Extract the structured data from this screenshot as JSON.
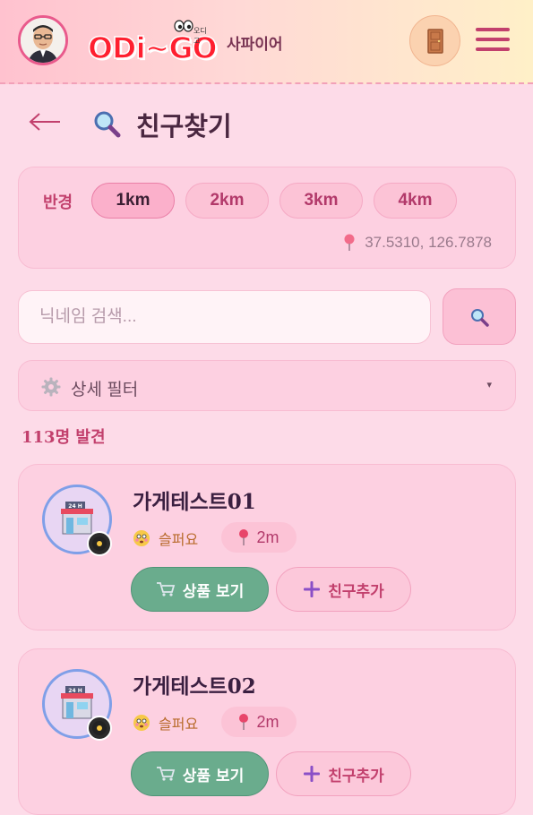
{
  "header": {
    "logo_text": "ODi~GO",
    "logo_small_text": "오디고",
    "username": "사파이어",
    "icons": {
      "avatar": "profile-photo",
      "door": "door-icon",
      "menu": "hamburger-menu-icon"
    }
  },
  "page": {
    "back_icon": "arrow-left-icon",
    "title_icon": "magnifier-icon",
    "title": "친구찾기"
  },
  "radius": {
    "label": "반경",
    "options": [
      "1km",
      "2km",
      "3km",
      "4km"
    ],
    "selected": "1km",
    "location_icon": "pushpin-icon",
    "coordinates": "37.5310, 126.7878"
  },
  "search": {
    "placeholder": "닉네임 검색...",
    "value": "",
    "button_icon": "magnifier-icon"
  },
  "filter": {
    "icon": "gear-icon",
    "label": "상세 필터",
    "caret": "▾"
  },
  "results": {
    "count_text": "113명 발견",
    "items": [
      {
        "name": "가게테스트01",
        "avatar_icon": "convenience-store-icon",
        "mood_icon": "flushed-face-icon",
        "mood": "슬퍼요",
        "distance": "2m",
        "products_label": "상품 보기",
        "add_friend_label": "친구추가"
      },
      {
        "name": "가게테스트02",
        "avatar_icon": "convenience-store-icon",
        "mood_icon": "flushed-face-icon",
        "mood": "슬퍼요",
        "distance": "2m",
        "products_label": "상품 보기",
        "add_friend_label": "친구추가"
      }
    ]
  },
  "colors": {
    "background": "#fddbe8",
    "accent": "#c2406d",
    "panel": "#fdd0e1",
    "products_button": "#6aac8d"
  }
}
